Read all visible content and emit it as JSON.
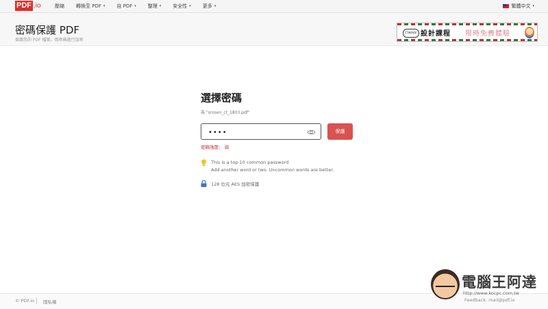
{
  "nav": {
    "logo_pdf": "PDF",
    "logo_io": ".io",
    "items": [
      {
        "label": "壓縮",
        "has_caret": false
      },
      {
        "label": "轉換至 PDF",
        "has_caret": true
      },
      {
        "label": "自 PDF",
        "has_caret": true
      },
      {
        "label": "整理",
        "has_caret": true
      },
      {
        "label": "安全性",
        "has_caret": true
      },
      {
        "label": "更多",
        "has_caret": true
      }
    ],
    "caret": "▾",
    "language": "繁體中文",
    "language_caret": "▾"
  },
  "header": {
    "title": "密碼保護 PDF",
    "subtitle": "保護您的 PDF 檔案，用密碼進行加密"
  },
  "ad": {
    "badge": "Classic",
    "text_main": "設計課程",
    "text_promo": "限時免費體驗"
  },
  "form": {
    "title": "選擇密碼",
    "file_note": "為 \"srosen_ct_1803.pdf\"",
    "password_value": "••••",
    "protect_label": "保護",
    "strength_label": "密碼強度：",
    "strength_value": "弱",
    "hint_line1": "This is a top-10 common password",
    "hint_line2": "Add another word or two. Uncommon words are better.",
    "aes_text": "128 位元 AES 加密保護"
  },
  "footer": {
    "copyright": "© PDF.io",
    "privacy": "隱私權",
    "feedback": "Feedback: mail@pdf.io"
  },
  "watermark": {
    "title": "電腦王阿達",
    "url": "http://www.kocpc.com.tw"
  },
  "colors": {
    "brand_red": "#d9322a",
    "button_red": "#d9534f",
    "weak_red": "#c9302c",
    "bulb_yellow": "#f5c518",
    "lock_blue": "#3b73d6"
  }
}
